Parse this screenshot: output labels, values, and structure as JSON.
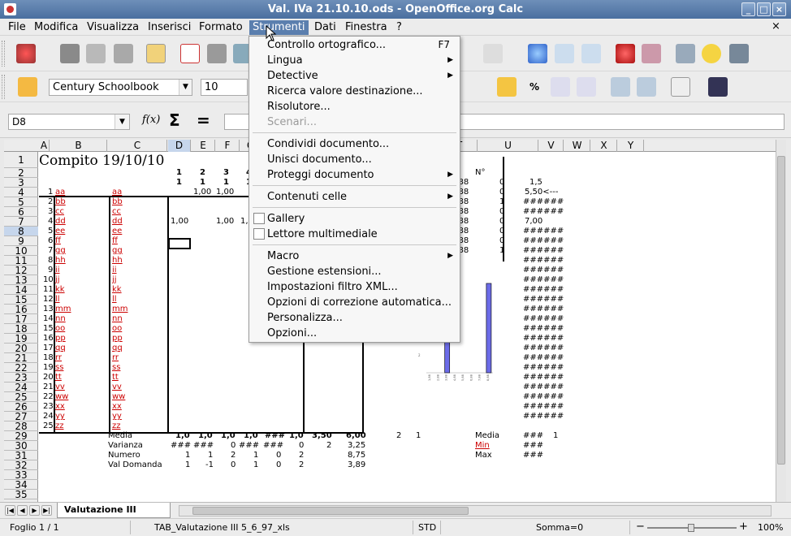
{
  "window": {
    "title": "Val. IVa 21.10.10.ods - OpenOffice.org Calc",
    "minimize": "_",
    "maximize": "□",
    "close": "×"
  },
  "menubar": {
    "items": [
      "File",
      "Modifica",
      "Visualizza",
      "Inserisci",
      "Formato",
      "Strumenti",
      "Dati",
      "Finestra",
      "?"
    ],
    "active": "Strumenti",
    "doc_close": "×"
  },
  "format_toolbar": {
    "font_name": "Century Schoolbook",
    "font_size": "10"
  },
  "formula_bar": {
    "cell_ref": "D8",
    "fx": "f(x)",
    "sum": "Σ",
    "equals": "=",
    "content": ""
  },
  "columns": [
    "A",
    "B",
    "C",
    "D",
    "E",
    "F",
    "G",
    "O",
    "P",
    "Q",
    "R",
    "S",
    "T",
    "U",
    "V",
    "W",
    "X",
    "Y"
  ],
  "active_column": "D",
  "rows": [
    "1",
    "2",
    "3",
    "4",
    "5",
    "6",
    "7",
    "8",
    "9",
    "10",
    "11",
    "12",
    "13",
    "14",
    "15",
    "16",
    "17",
    "18",
    "19",
    "20",
    "21",
    "22",
    "23",
    "24",
    "25",
    "26",
    "27",
    "28",
    "29",
    "30",
    "31",
    "32",
    "33",
    "34",
    "35"
  ],
  "active_row": "8",
  "sheet": {
    "title": "Compito 19/10/10",
    "header_row2": [
      "1",
      "2",
      "3",
      "4"
    ],
    "header_row3": [
      "1",
      "1",
      "1",
      "1"
    ],
    "o_header": "p",
    "p_header": "N°",
    "names": [
      [
        "1",
        "aa",
        "aa"
      ],
      [
        "2",
        "bb",
        "bb"
      ],
      [
        "3",
        "cc",
        "cc"
      ],
      [
        "4",
        "dd",
        "dd"
      ],
      [
        "5",
        "ee",
        "ee"
      ],
      [
        "6",
        "ff",
        "ff"
      ],
      [
        "7",
        "gg",
        "gg"
      ],
      [
        "8",
        "hh",
        "hh"
      ],
      [
        "9",
        "ii",
        "ii"
      ],
      [
        "10",
        "jj",
        "jj"
      ],
      [
        "11",
        "kk",
        "kk"
      ],
      [
        "12",
        "ll",
        "ll"
      ],
      [
        "13",
        "mm",
        "mm"
      ],
      [
        "14",
        "nn",
        "nn"
      ],
      [
        "15",
        "oo",
        "oo"
      ],
      [
        "16",
        "pp",
        "pp"
      ],
      [
        "17",
        "qq",
        "qq"
      ],
      [
        "18",
        "rr",
        "rr"
      ],
      [
        "19",
        "ss",
        "ss"
      ],
      [
        "20",
        "tt",
        "tt"
      ],
      [
        "21",
        "vv",
        "vv"
      ],
      [
        "22",
        "ww",
        "ww"
      ],
      [
        "23",
        "xx",
        "xx"
      ],
      [
        "24",
        "yy",
        "yy"
      ],
      [
        "25",
        "zz",
        "zz"
      ]
    ],
    "row4_values": [
      "1,00",
      "1,00"
    ],
    "row7_values": [
      "1,00",
      "1,00",
      "1,"
    ],
    "o_values": [
      "1,88",
      "2,88",
      "3,88",
      "4,88",
      "5,88",
      "6,88",
      "7,88",
      "8,88"
    ],
    "p_values": [
      "0",
      "0",
      "1",
      "0",
      "0",
      "0",
      "0",
      "1"
    ],
    "r_values": [
      "1,5",
      "5,50<---",
      "######",
      "######",
      "7,00",
      "######",
      "######",
      "######",
      "######",
      "######",
      "######",
      "######",
      "######",
      "######",
      "######",
      "######",
      "######",
      "######",
      "######",
      "######",
      "######",
      "######",
      "######",
      "######",
      "######"
    ],
    "media_label": "Media",
    "media_values": [
      "1,0",
      "1,0",
      "1,0",
      "1,0",
      "###",
      "1,0",
      "3,50",
      "6,00"
    ],
    "media_extra": [
      "2",
      "1"
    ],
    "varianza_label": "Varianza",
    "varianza_values": [
      "###",
      "###",
      "0",
      "###",
      "###",
      "0",
      "2",
      "3,25"
    ],
    "numero_label": "Numero",
    "numero_values": [
      "1",
      "1",
      "2",
      "1",
      "0",
      "2",
      "8,75"
    ],
    "valdomanda_label": "Val Domanda",
    "valdomanda_values": [
      "1",
      "-1",
      "0",
      "1",
      "0",
      "2",
      "3,89"
    ],
    "side_stats": [
      [
        "Media",
        "###",
        "1"
      ],
      [
        "Min",
        "###",
        ""
      ],
      [
        "Max",
        "###",
        ""
      ]
    ]
  },
  "chart_data": {
    "type": "bar",
    "categories": [
      "1,88",
      "2,88",
      "3,88",
      "4,88",
      "5,88",
      "6,88",
      "7,88",
      "8,88"
    ],
    "values": [
      0,
      0,
      1,
      0,
      0,
      0,
      0,
      1
    ],
    "title": "",
    "xlabel": "",
    "ylabel": "",
    "y_ticks": [
      "2",
      "1"
    ]
  },
  "tabs": {
    "nav": [
      "|◀",
      "◀",
      "▶",
      "▶|"
    ],
    "active_sheet": "Valutazione III 5_6_9..."
  },
  "statusbar": {
    "sheet": "Foglio 1 / 1",
    "page_style": "TAB_Valutazione III 5_6_97_xls",
    "mode": "STD",
    "sum": "Somma=0",
    "zoom": "100%",
    "zoom_minus": "−",
    "zoom_plus": "+"
  },
  "strumenti_menu": [
    {
      "label": "Controllo ortografico...",
      "shortcut": "F7",
      "submenu": false,
      "disabled": false,
      "checkbox": false
    },
    {
      "label": "Lingua",
      "shortcut": "",
      "submenu": true,
      "disabled": false,
      "checkbox": false
    },
    {
      "label": "Detective",
      "shortcut": "",
      "submenu": true,
      "disabled": false,
      "checkbox": false
    },
    {
      "label": "Ricerca valore destinazione...",
      "shortcut": "",
      "submenu": false,
      "disabled": false,
      "checkbox": false
    },
    {
      "label": "Risolutore...",
      "shortcut": "",
      "submenu": false,
      "disabled": false,
      "checkbox": false
    },
    {
      "label": "Scenari...",
      "shortcut": "",
      "submenu": false,
      "disabled": true,
      "checkbox": false
    },
    {
      "sep": true
    },
    {
      "label": "Condividi documento...",
      "shortcut": "",
      "submenu": false,
      "disabled": false,
      "checkbox": false
    },
    {
      "label": "Unisci documento...",
      "shortcut": "",
      "submenu": false,
      "disabled": false,
      "checkbox": false
    },
    {
      "label": "Proteggi documento",
      "shortcut": "",
      "submenu": true,
      "disabled": false,
      "checkbox": false
    },
    {
      "sep": true
    },
    {
      "label": "Contenuti celle",
      "shortcut": "",
      "submenu": true,
      "disabled": false,
      "checkbox": false
    },
    {
      "sep": true
    },
    {
      "label": "Gallery",
      "shortcut": "",
      "submenu": false,
      "disabled": false,
      "checkbox": true
    },
    {
      "label": "Lettore multimediale",
      "shortcut": "",
      "submenu": false,
      "disabled": false,
      "checkbox": true
    },
    {
      "sep": true
    },
    {
      "label": "Macro",
      "shortcut": "",
      "submenu": true,
      "disabled": false,
      "checkbox": false
    },
    {
      "label": "Gestione estensioni...",
      "shortcut": "",
      "submenu": false,
      "disabled": false,
      "checkbox": false
    },
    {
      "label": "Impostazioni filtro XML...",
      "shortcut": "",
      "submenu": false,
      "disabled": false,
      "checkbox": false
    },
    {
      "label": "Opzioni di correzione automatica...",
      "shortcut": "",
      "submenu": false,
      "disabled": false,
      "checkbox": false
    },
    {
      "label": "Personalizza...",
      "shortcut": "",
      "submenu": false,
      "disabled": false,
      "checkbox": false
    },
    {
      "label": "Opzioni...",
      "shortcut": "",
      "submenu": false,
      "disabled": false,
      "checkbox": false
    }
  ]
}
